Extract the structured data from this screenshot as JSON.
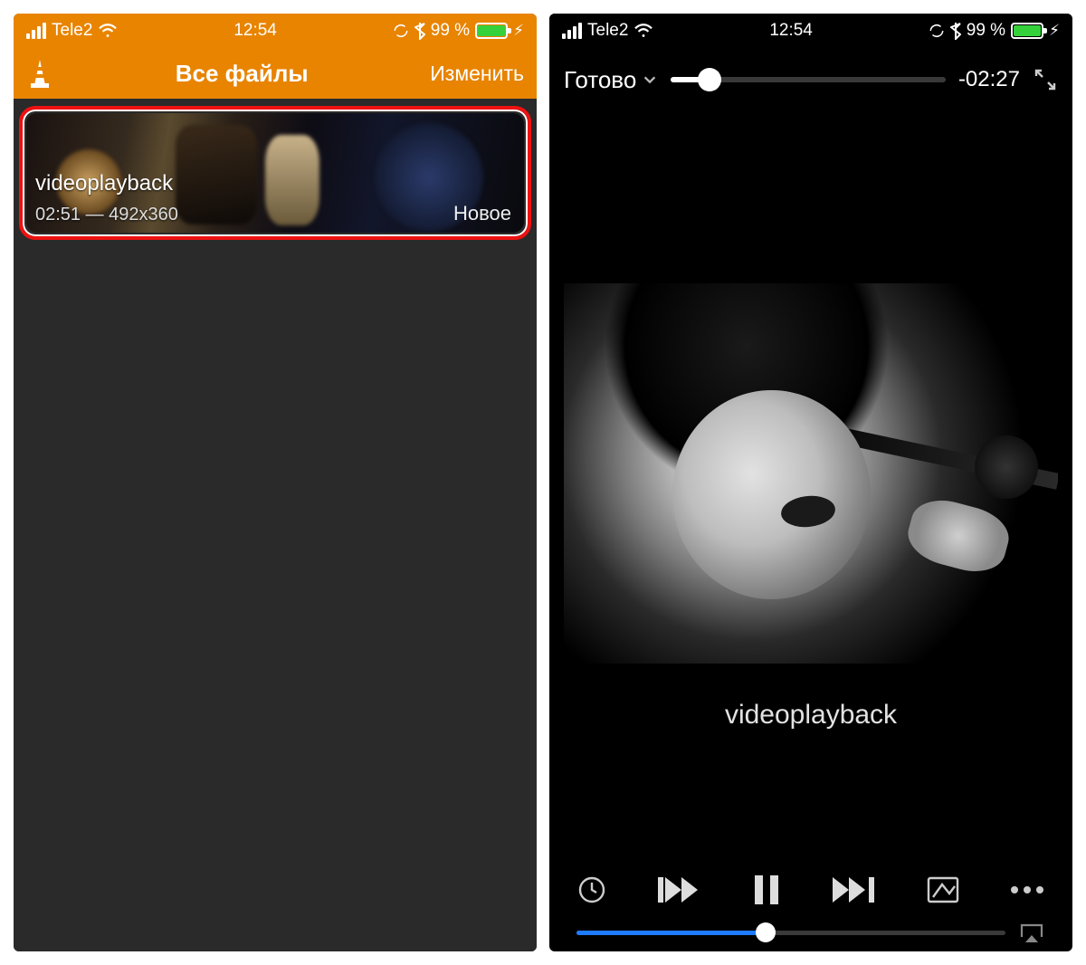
{
  "status": {
    "carrier": "Tele2",
    "time": "12:54",
    "battery_pct": "99 %",
    "battery_fill_color": "#35d13a"
  },
  "left": {
    "nav_title": "Все файлы",
    "nav_edit": "Изменить",
    "card": {
      "title": "videoplayback",
      "meta": "02:51 — 492x360",
      "badge": "Новое"
    }
  },
  "right": {
    "done": "Готово",
    "time_remaining": "-02:27",
    "seek_progress_pct": 14,
    "now_playing": "videoplayback",
    "volume_pct": 44,
    "icons": {
      "clock": "clock-icon",
      "prev": "skip-previous-icon",
      "pause": "pause-icon",
      "next": "skip-next-icon",
      "aspect": "aspect-ratio-icon",
      "more": "more-icon",
      "airplay": "airplay-icon",
      "fullscreen": "fullscreen-icon",
      "chevron": "chevron-down-icon"
    }
  }
}
